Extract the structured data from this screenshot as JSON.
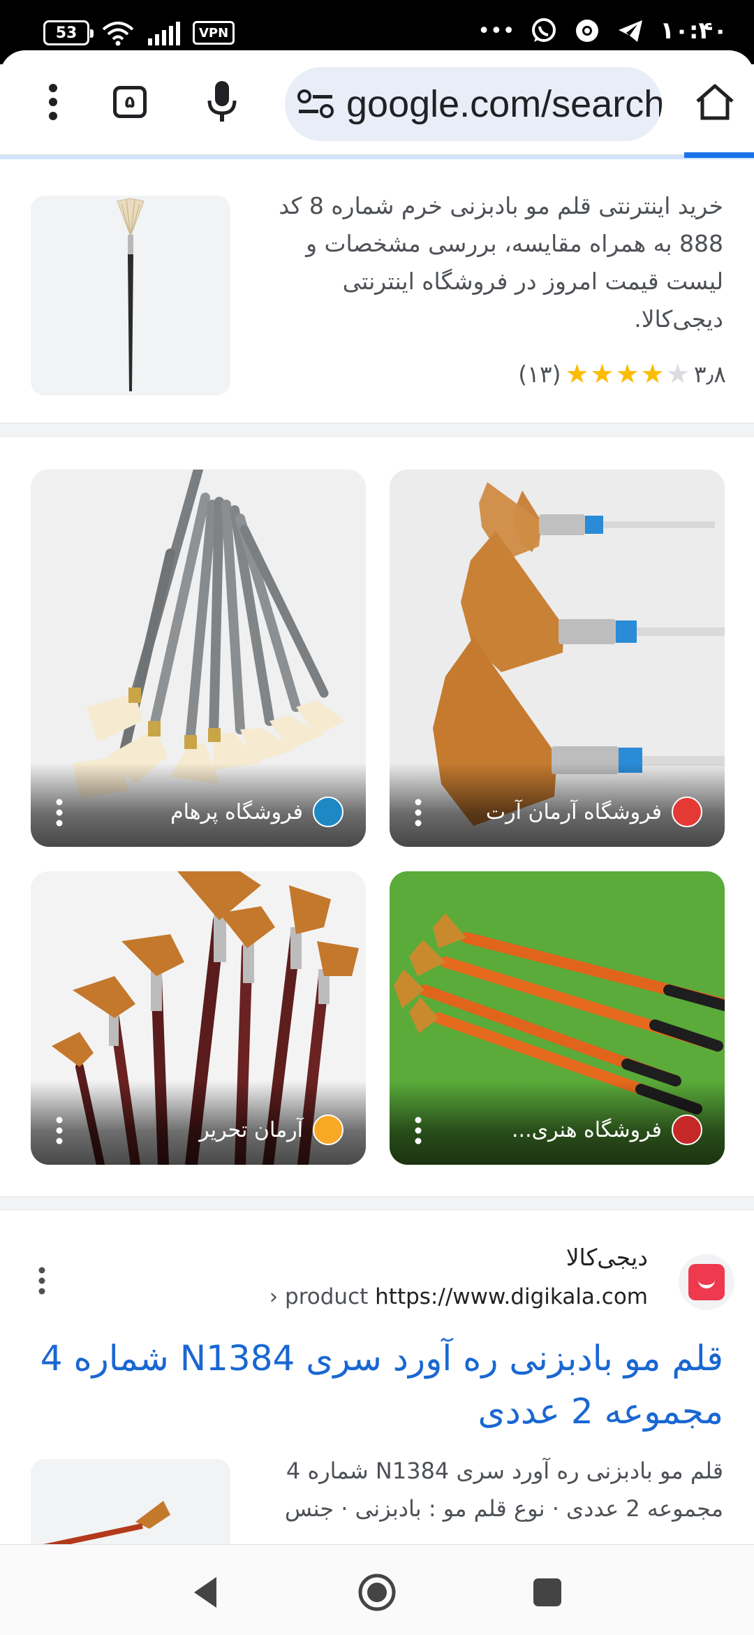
{
  "status_bar": {
    "battery": "53",
    "vpn": "VPN",
    "dots": "•••",
    "time": "۱۰:۴۰"
  },
  "toolbar": {
    "tab_count": "۵",
    "url": "google.com/search"
  },
  "result1": {
    "description": "خرید اینترنتی قلم مو بادبزنی خرم شماره 8 کد 888 به همراه مقایسه، بررسی مشخصات و لیست قیمت امروز در فروشگاه اینترنتی دیجی‌کالا.",
    "rating_value": "۳٫۸",
    "rating_count": "(۱۳)",
    "rating_stars": 4
  },
  "image_results": [
    {
      "source": "فروشگاه آرمان آرت",
      "icon_color": "#e53935"
    },
    {
      "source": "فروشگاه پرهام",
      "icon_color": "#1e88c5"
    },
    {
      "source": "فروشگاه هنری...",
      "icon_color": "#c62828"
    },
    {
      "source": "آرمان تحریر",
      "icon_color": "#f9a825"
    }
  ],
  "result2": {
    "site_name": "دیجی‌کالا",
    "url_domain": "https://www.digikala.com",
    "url_path": " › product",
    "title": "قلم مو بادبزنی ره آورد سری N1384 شماره 4 مجموعه 2 عددی",
    "description": "قلم مو بادبزنی ره آورد سری N1384 شماره 4 مجموعه 2 عددی · نوع قلم مو : بادبزنی · جنس"
  },
  "colors": {
    "link": "#1967d2",
    "star": "#fbbc04",
    "digikala": "#ef394e"
  }
}
